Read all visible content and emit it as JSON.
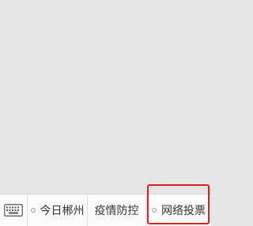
{
  "menu": {
    "keyboard_icon": "keyboard-icon",
    "items": [
      {
        "label": "今日郴州",
        "icon": "submenu-dot-icon"
      },
      {
        "label": "疫情防控"
      },
      {
        "label": "网络投票",
        "icon": "submenu-dot-icon"
      }
    ]
  },
  "colors": {
    "background": "#e6e6e6",
    "menu_bar": "#fcfcfc",
    "text": "#333333",
    "highlight": "#e02020"
  }
}
